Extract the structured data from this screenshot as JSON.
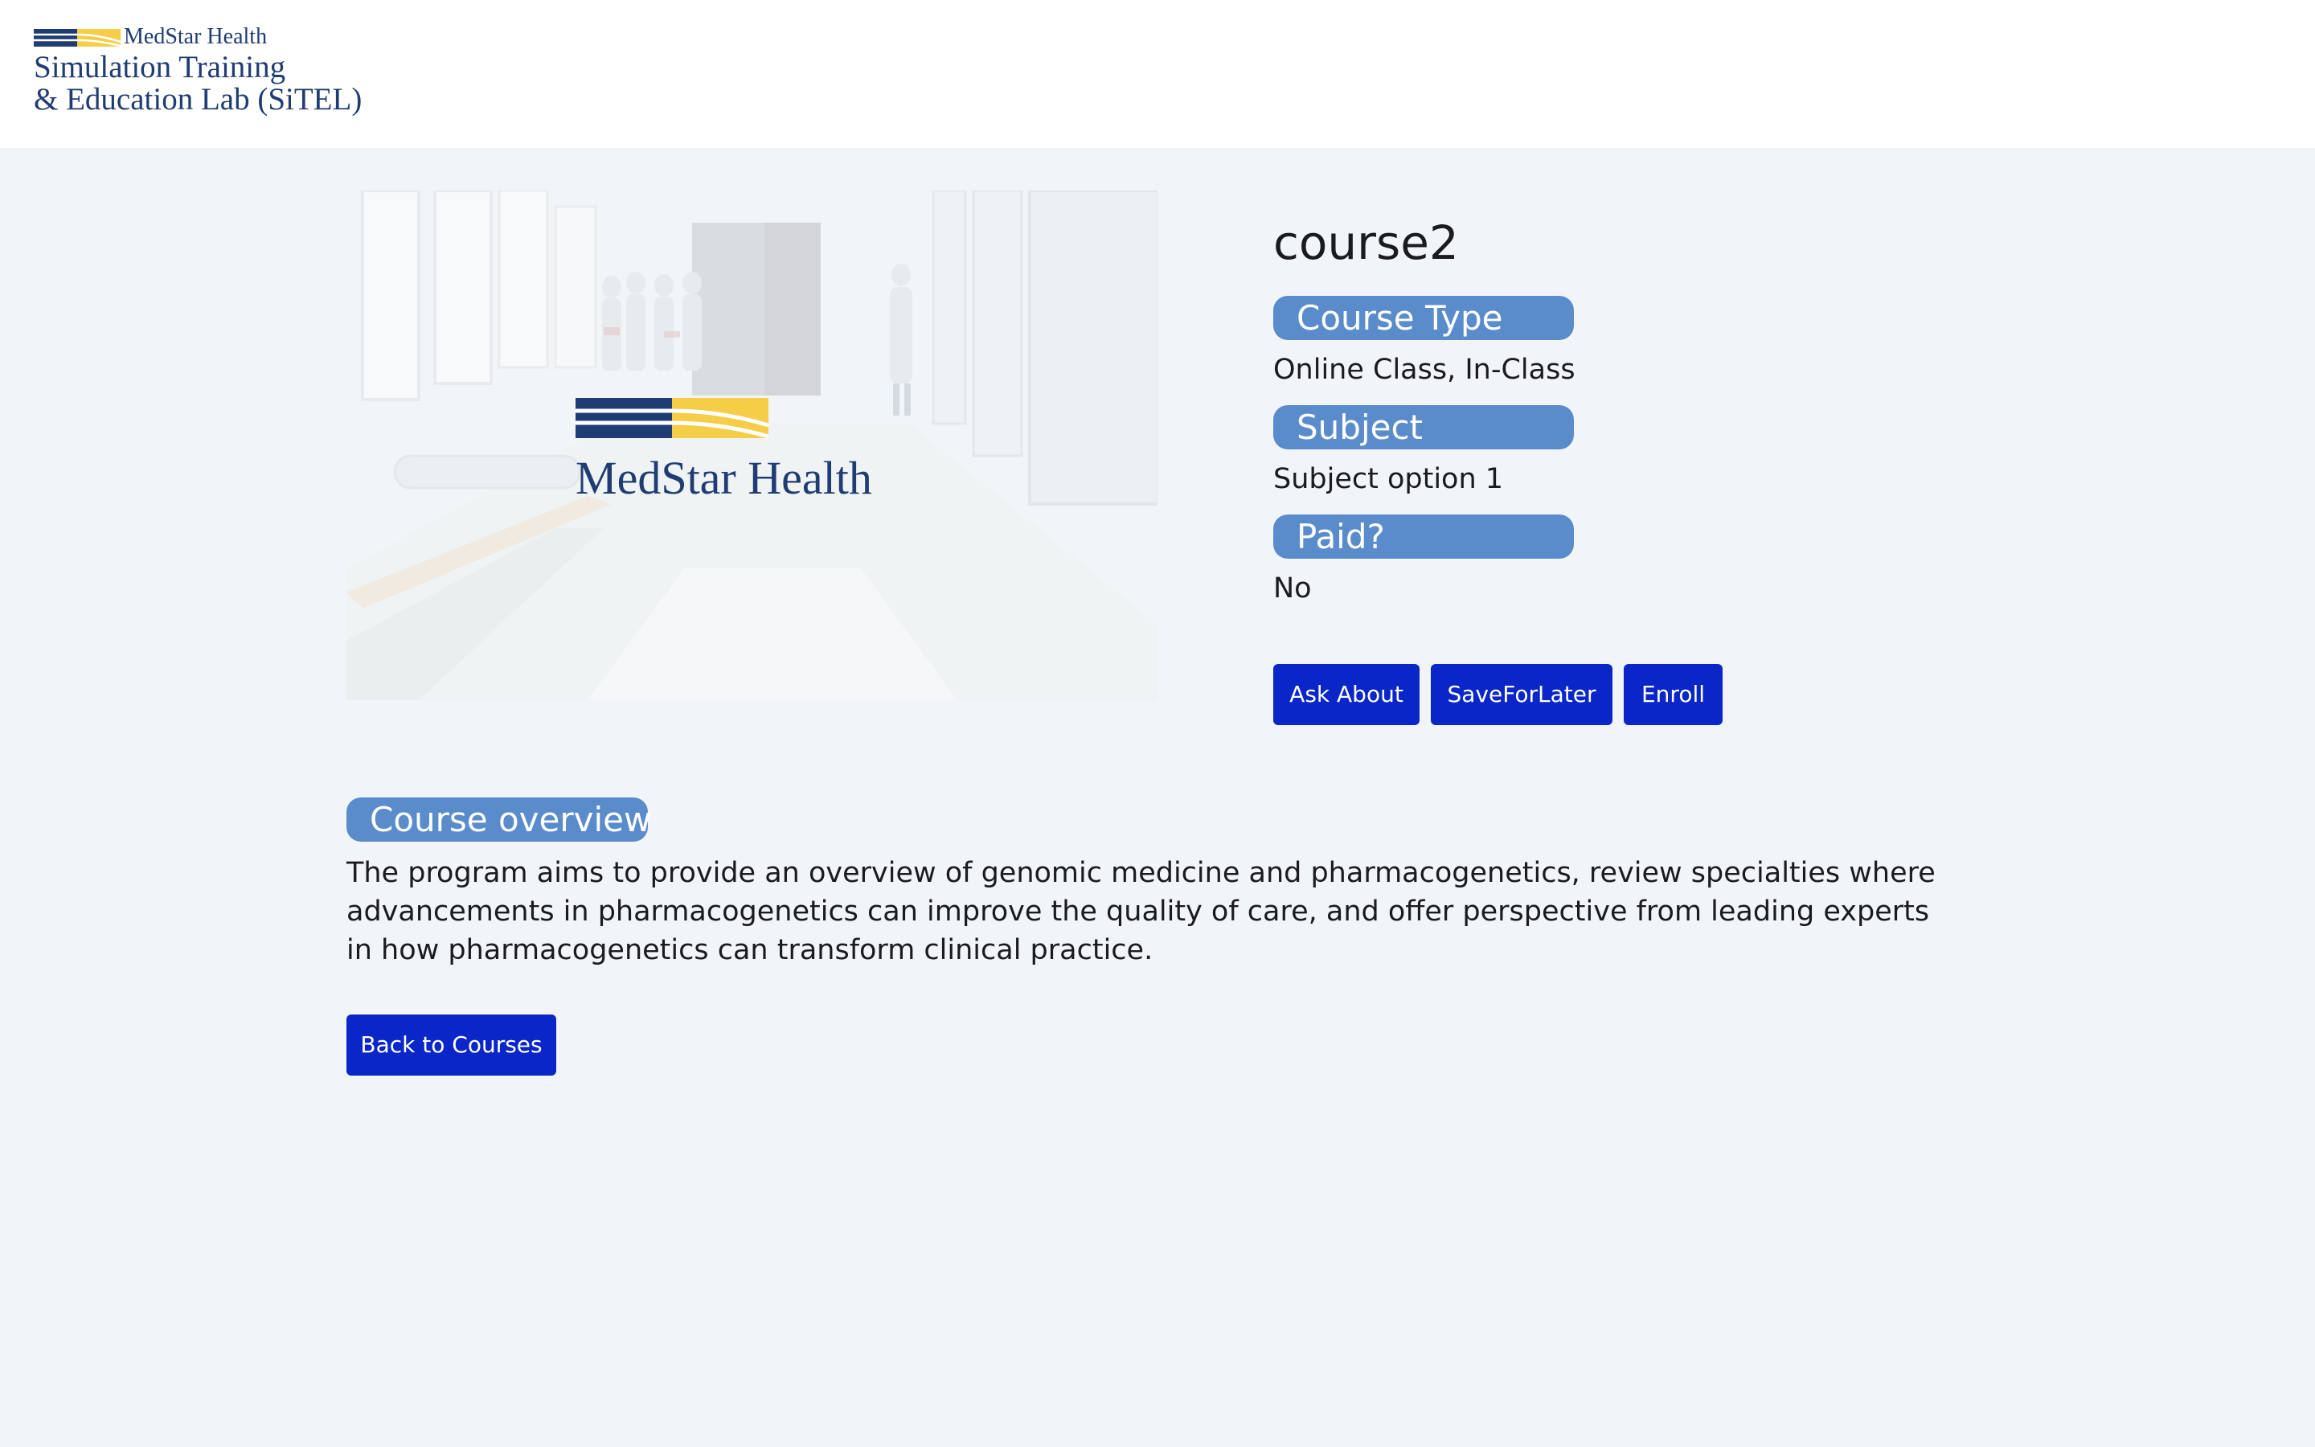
{
  "header": {
    "logo_brand": "MedStar Health",
    "logo_line1": "Simulation Training",
    "logo_line2": "& Education Lab (SiTEL)"
  },
  "hero": {
    "logo_text": "MedStar Health"
  },
  "course": {
    "title": "course2",
    "course_type_label": "Course Type",
    "course_type_value": "Online Class, In-Class",
    "subject_label": "Subject",
    "subject_value": "Subject option 1",
    "paid_label": "Paid?",
    "paid_value": "No"
  },
  "actions": {
    "ask_label": "Ask About",
    "save_label": "SaveForLater",
    "enroll_label": "Enroll",
    "back_label": "Back to Courses"
  },
  "overview": {
    "label": "Course overview",
    "text": "The program aims to provide an overview of genomic medicine and pharmacogenetics, review specialties where advancements in pharmacogenetics can improve the quality of care, and offer perspective from leading experts in how pharmacogenetics can transform clinical practice."
  },
  "colors": {
    "background": "#f1f5f9",
    "pill": "#5a8ccb",
    "button": "#0a26c8",
    "brand_navy": "#1f3c73",
    "brand_yellow": "#f5cd47"
  }
}
